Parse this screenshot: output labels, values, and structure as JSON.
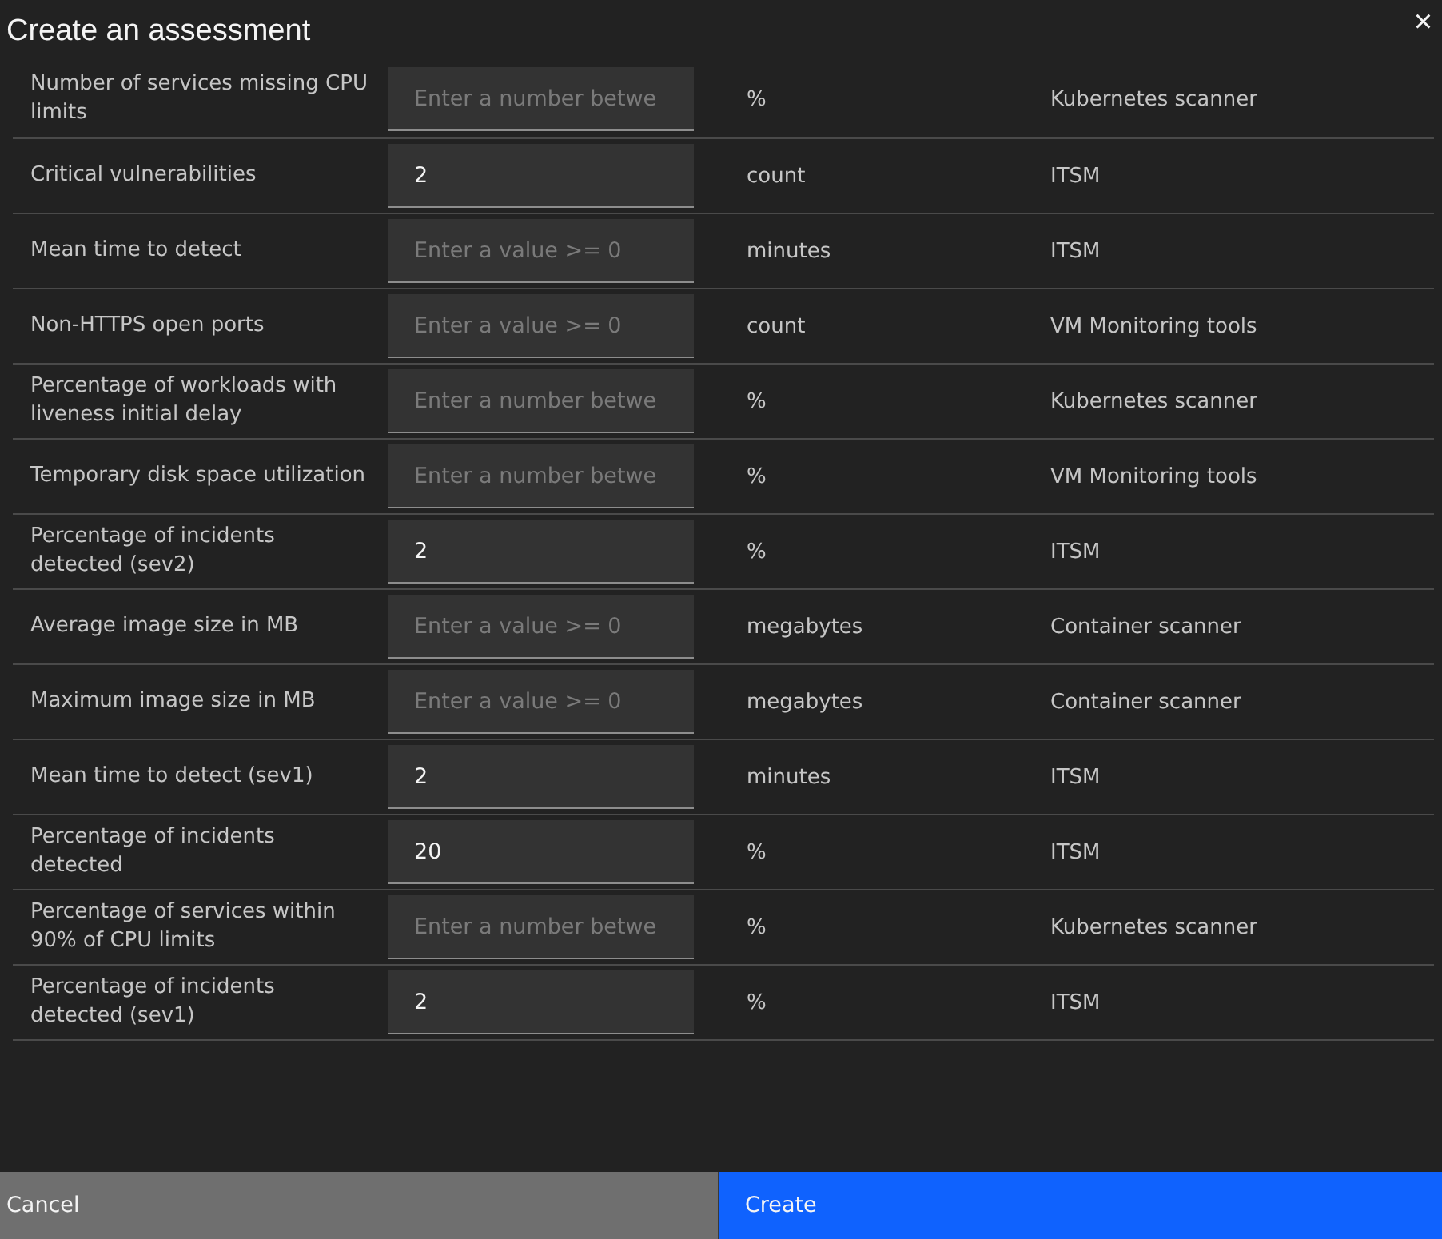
{
  "dialog": {
    "title": "Create an assessment",
    "close_icon": "×"
  },
  "rows": [
    {
      "metric": "Number of services missing CPU limits",
      "value": "",
      "placeholder": "Enter a number betwe",
      "unit": "%",
      "source": "Kubernetes scanner"
    },
    {
      "metric": "Critical vulnerabilities",
      "value": "2",
      "placeholder": "",
      "unit": "count",
      "source": "ITSM"
    },
    {
      "metric": "Mean time to detect",
      "value": "",
      "placeholder": "Enter a value >= 0",
      "unit": "minutes",
      "source": "ITSM"
    },
    {
      "metric": "Non-HTTPS open ports",
      "value": "",
      "placeholder": "Enter a value >= 0",
      "unit": "count",
      "source": "VM Monitoring tools"
    },
    {
      "metric": "Percentage of workloads with liveness initial delay",
      "value": "",
      "placeholder": "Enter a number betwe",
      "unit": "%",
      "source": "Kubernetes scanner"
    },
    {
      "metric": "Temporary disk space utilization",
      "value": "",
      "placeholder": "Enter a number betwe",
      "unit": "%",
      "source": "VM Monitoring tools"
    },
    {
      "metric": "Percentage of incidents detected (sev2)",
      "value": "2",
      "placeholder": "",
      "unit": "%",
      "source": "ITSM"
    },
    {
      "metric": "Average image size in MB",
      "value": "",
      "placeholder": "Enter a value >= 0",
      "unit": "megabytes",
      "source": "Container scanner"
    },
    {
      "metric": "Maximum image size in MB",
      "value": "",
      "placeholder": "Enter a value >= 0",
      "unit": "megabytes",
      "source": "Container scanner"
    },
    {
      "metric": "Mean time to detect (sev1)",
      "value": "2",
      "placeholder": "",
      "unit": "minutes",
      "source": "ITSM"
    },
    {
      "metric": "Percentage of incidents detected",
      "value": "20",
      "placeholder": "",
      "unit": "%",
      "source": "ITSM"
    },
    {
      "metric": "Percentage of services within 90% of CPU limits",
      "value": "",
      "placeholder": "Enter a number betwe",
      "unit": "%",
      "source": "Kubernetes scanner"
    },
    {
      "metric": "Percentage of incidents detected (sev1)",
      "value": "2",
      "placeholder": "",
      "unit": "%",
      "source": "ITSM"
    }
  ],
  "buttons": {
    "cancel": "Cancel",
    "create": "Create"
  }
}
